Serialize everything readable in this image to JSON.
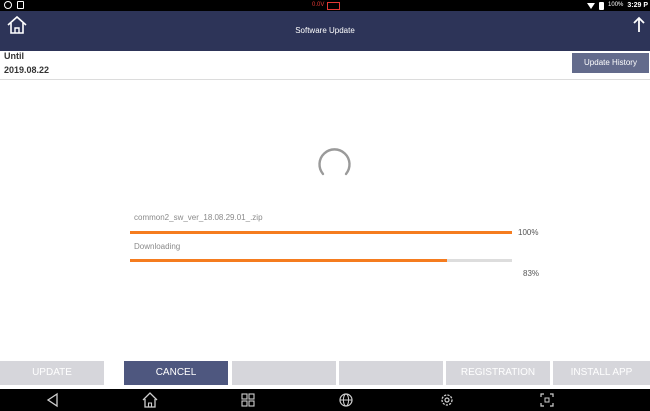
{
  "statusbar": {
    "voltage": "0.0V",
    "battery_percent": "100%",
    "time": "3:29 P"
  },
  "titlebar": {
    "title": "Software Update"
  },
  "info": {
    "until_label": "Until",
    "until_date": "2019.08.22",
    "history_button": "Update History"
  },
  "progress": {
    "file_name": "common2_sw_ver_18.08.29.01_.zip",
    "file_percent_text": "100%",
    "file_fraction": 1.0,
    "status": "Downloading",
    "overall_percent_text": "83%",
    "overall_fraction": 0.83
  },
  "buttons": [
    {
      "label": "UPDATE",
      "enabled": false
    },
    {
      "label": "CANCEL",
      "enabled": true
    },
    {
      "label": "",
      "enabled": false
    },
    {
      "label": "",
      "enabled": false
    },
    {
      "label": "REGISTRATION",
      "enabled": false
    },
    {
      "label": "INSTALL APP",
      "enabled": false
    }
  ],
  "navbar": {
    "icons": [
      "back-icon",
      "home-icon",
      "recent-apps-icon",
      "browser-icon",
      "settings-icon",
      "screenshot-icon"
    ]
  },
  "colors": {
    "title_bar": "#2d3458",
    "accent_orange": "#f57c1f",
    "active_button": "#4e577f",
    "disabled_button": "#d6d6db"
  }
}
